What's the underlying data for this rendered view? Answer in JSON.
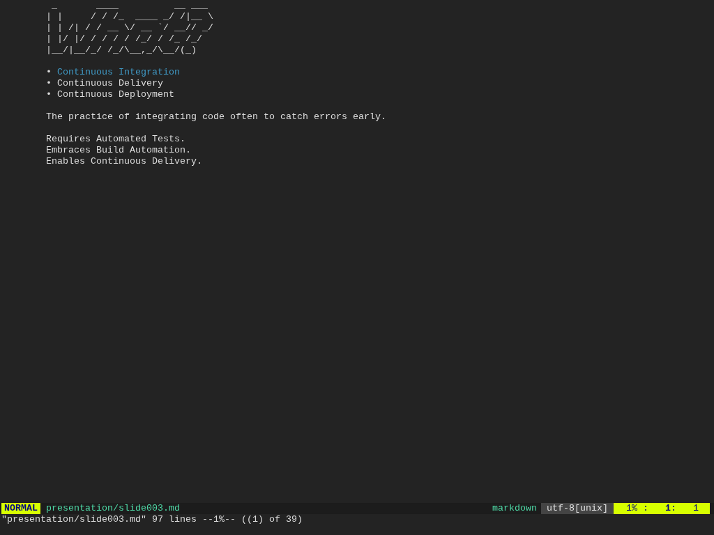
{
  "banner": [
    " _       ____          __ ___ ",
    "| |     / / /_  ____ _/ /|__ \\",
    "| | /| / / __ \\/ __ `/ __// _/",
    "| |/ |/ / / / / /_/ / /_ /_/  ",
    "|__/|__/_/ /_/\\__,_/\\__/(_)   "
  ],
  "bullets": [
    {
      "label": "Continuous Integration",
      "selected": true
    },
    {
      "label": "Continuous Delivery",
      "selected": false
    },
    {
      "label": "Continuous Deployment",
      "selected": false
    }
  ],
  "bullet_mark": "•",
  "description": "The practice of integrating code often to catch errors early.",
  "notes": [
    "Requires Automated Tests.",
    "Embraces Build Automation.",
    "Enables Continuous Delivery."
  ],
  "status_bar": {
    "mode": "NORMAL",
    "file": "presentation/slide003.md",
    "filetype": "markdown",
    "encoding": "utf-8[unix]",
    "percent": "1%",
    "sep1": ":",
    "line": "1",
    "sep2": ":",
    "column": "1"
  },
  "command_line": "\"presentation/slide003.md\" 97 lines --1%-- ((1) of 39)"
}
